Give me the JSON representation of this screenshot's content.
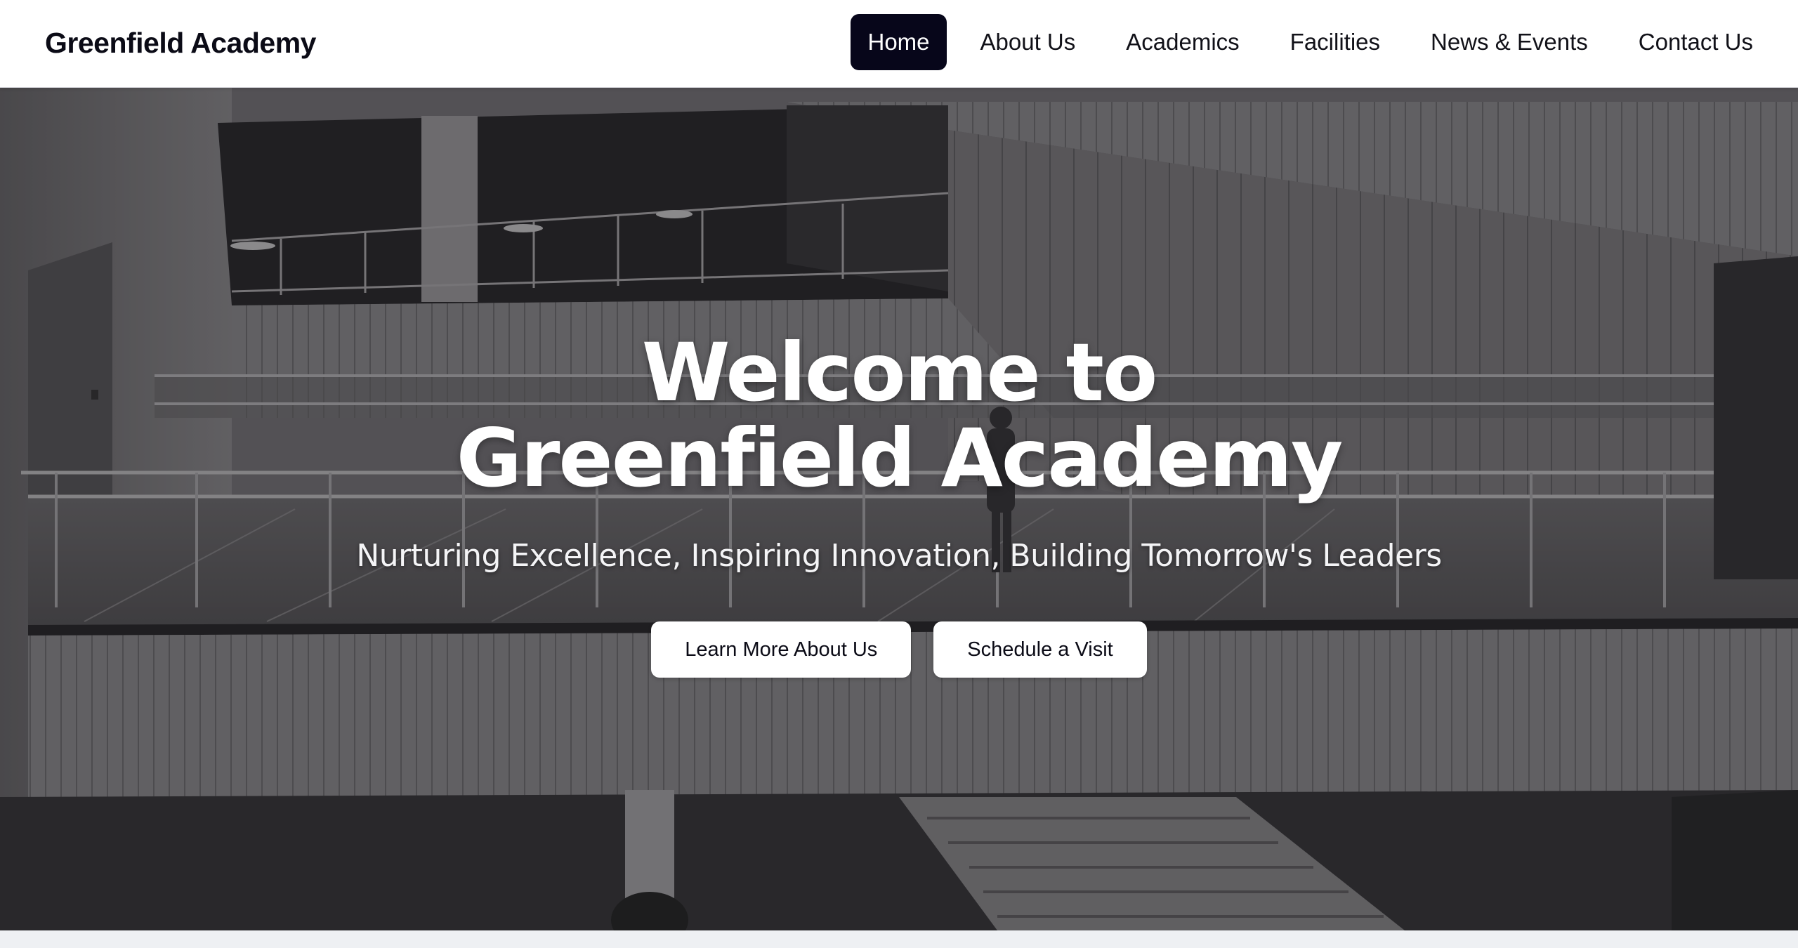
{
  "header": {
    "brand": "Greenfield Academy",
    "nav": [
      {
        "label": "Home",
        "active": true
      },
      {
        "label": "About Us",
        "active": false
      },
      {
        "label": "Academics",
        "active": false
      },
      {
        "label": "Facilities",
        "active": false
      },
      {
        "label": "News & Events",
        "active": false
      },
      {
        "label": "Contact Us",
        "active": false
      }
    ]
  },
  "hero": {
    "title": "Welcome to Greenfield Academy",
    "subtitle": "Nurturing Excellence, Inspiring Innovation, Building Tomorrow's Leaders",
    "buttons": {
      "learn_more": "Learn More About Us",
      "schedule": "Schedule a Visit"
    },
    "image_subject": "grayscale atrium interior with glass-railed walkways and staircase"
  },
  "colors": {
    "active_nav": "#07061a",
    "header_bg": "#ffffff",
    "page_bg": "#eef0f3"
  }
}
